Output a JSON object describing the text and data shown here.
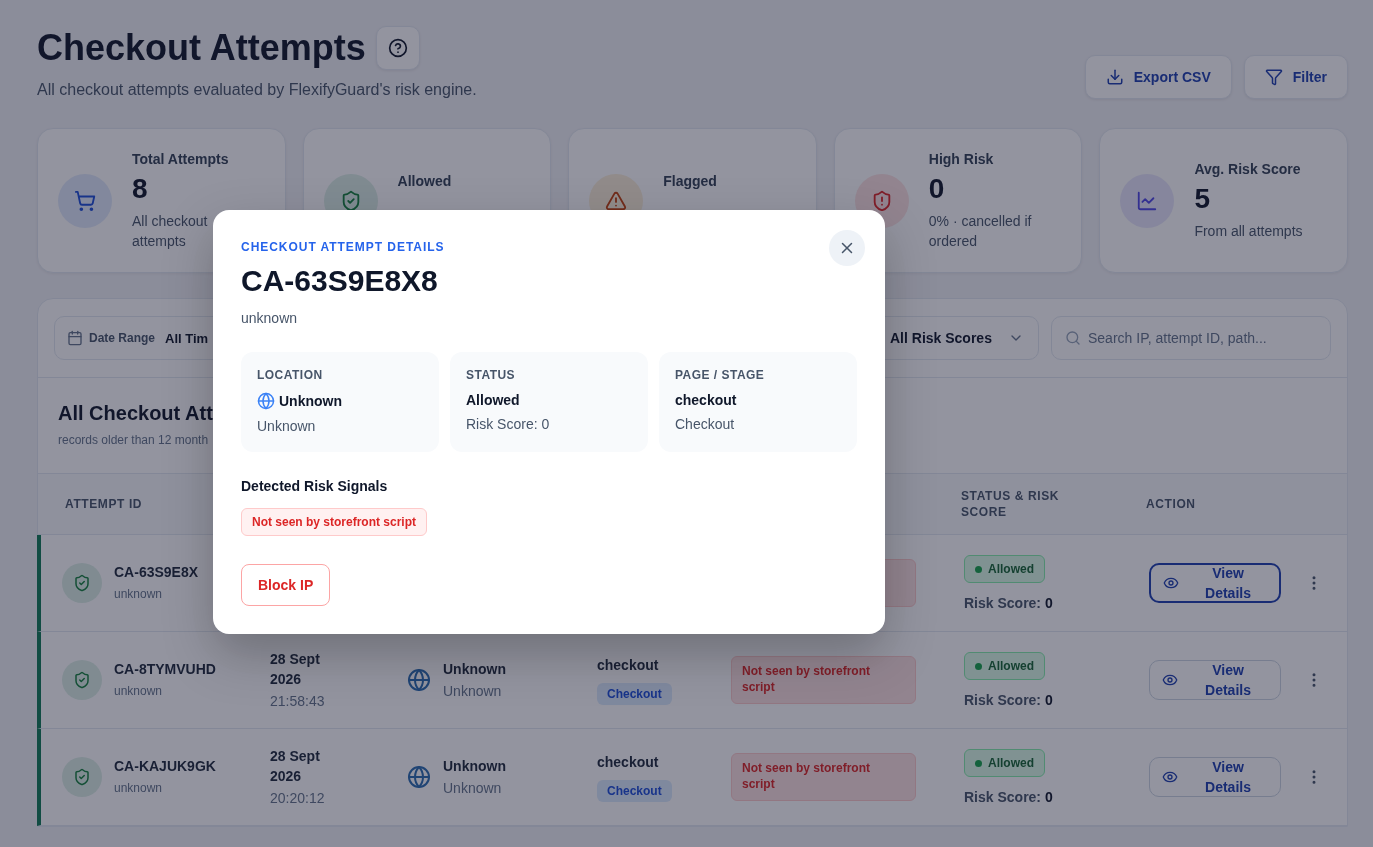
{
  "header": {
    "title": "Checkout Attempts",
    "subtitle": "All checkout attempts evaluated by FlexifyGuard's risk engine.",
    "actions": [
      "Export CSV",
      "Filter"
    ]
  },
  "stats": [
    {
      "title": "Total Attempts",
      "value": "8",
      "note": "All checkout attempts"
    },
    {
      "title": "Allowed"
    },
    {
      "title": "Flagged"
    },
    {
      "title": "High Risk",
      "value": "0",
      "note": "0% · cancelled if ordered"
    },
    {
      "title": "Avg. Risk Score",
      "value": "5",
      "note": "From all attempts"
    }
  ],
  "filters": {
    "date_label": "Date Range",
    "date_value": "All Tim",
    "risk_select": "All Risk Scores",
    "search_placeholder": "Search IP, attempt ID, path..."
  },
  "section": {
    "title": "All Checkout Att",
    "note": "records older than 12 month"
  },
  "table": {
    "columns": {
      "attempt_id": "ATTEMPT ID",
      "status": "STATUS & RISK SCORE",
      "action": "ACTION"
    },
    "rows": [
      {
        "id": "CA-63S9E8X",
        "source": "unknown",
        "kind": "allowed",
        "status_label": "Allowed",
        "score": "Risk Score: **0**",
        "action": "View Details",
        "focused": true
      },
      {
        "id": "CA-8TYMVUHD",
        "source": "unknown",
        "date": "28 Sept 2026",
        "time": "21:58:43",
        "location": "Unknown",
        "region": "Unknown",
        "page": "checkout",
        "stage": "Checkout",
        "signal": "Not seen by storefront script",
        "kind": "allowed",
        "status_label": "Allowed",
        "score": "Risk Score: **0**",
        "action": "View Details",
        "focused": false
      },
      {
        "id": "CA-KAJUK9GK",
        "source": "unknown",
        "date": "28 Sept 2026",
        "time": "20:20:12",
        "location": "Unknown",
        "region": "Unknown",
        "page": "checkout",
        "stage": "Checkout",
        "signal": "Not seen by storefront script",
        "kind": "allowed",
        "status_label": "Allowed",
        "score": "Risk Score: **0**",
        "action": "View Details",
        "focused": false
      }
    ]
  },
  "modal": {
    "eyebrow": "CHECKOUT ATTEMPT DETAILS",
    "title": "CA-63S9E8X8",
    "subtitle": "unknown",
    "info": [
      {
        "kind": "location",
        "label": "LOCATION",
        "value": "Unknown",
        "sub": "Unknown"
      },
      {
        "kind": "plain",
        "label": "STATUS",
        "value": "Allowed",
        "sub": "Risk Score: 0"
      },
      {
        "kind": "plain",
        "label": "PAGE / STAGE",
        "value": "checkout",
        "sub": "Checkout"
      }
    ],
    "signals_title": "Detected Risk Signals",
    "signals": [
      "Not seen by storefront script"
    ],
    "action": "Block IP"
  }
}
